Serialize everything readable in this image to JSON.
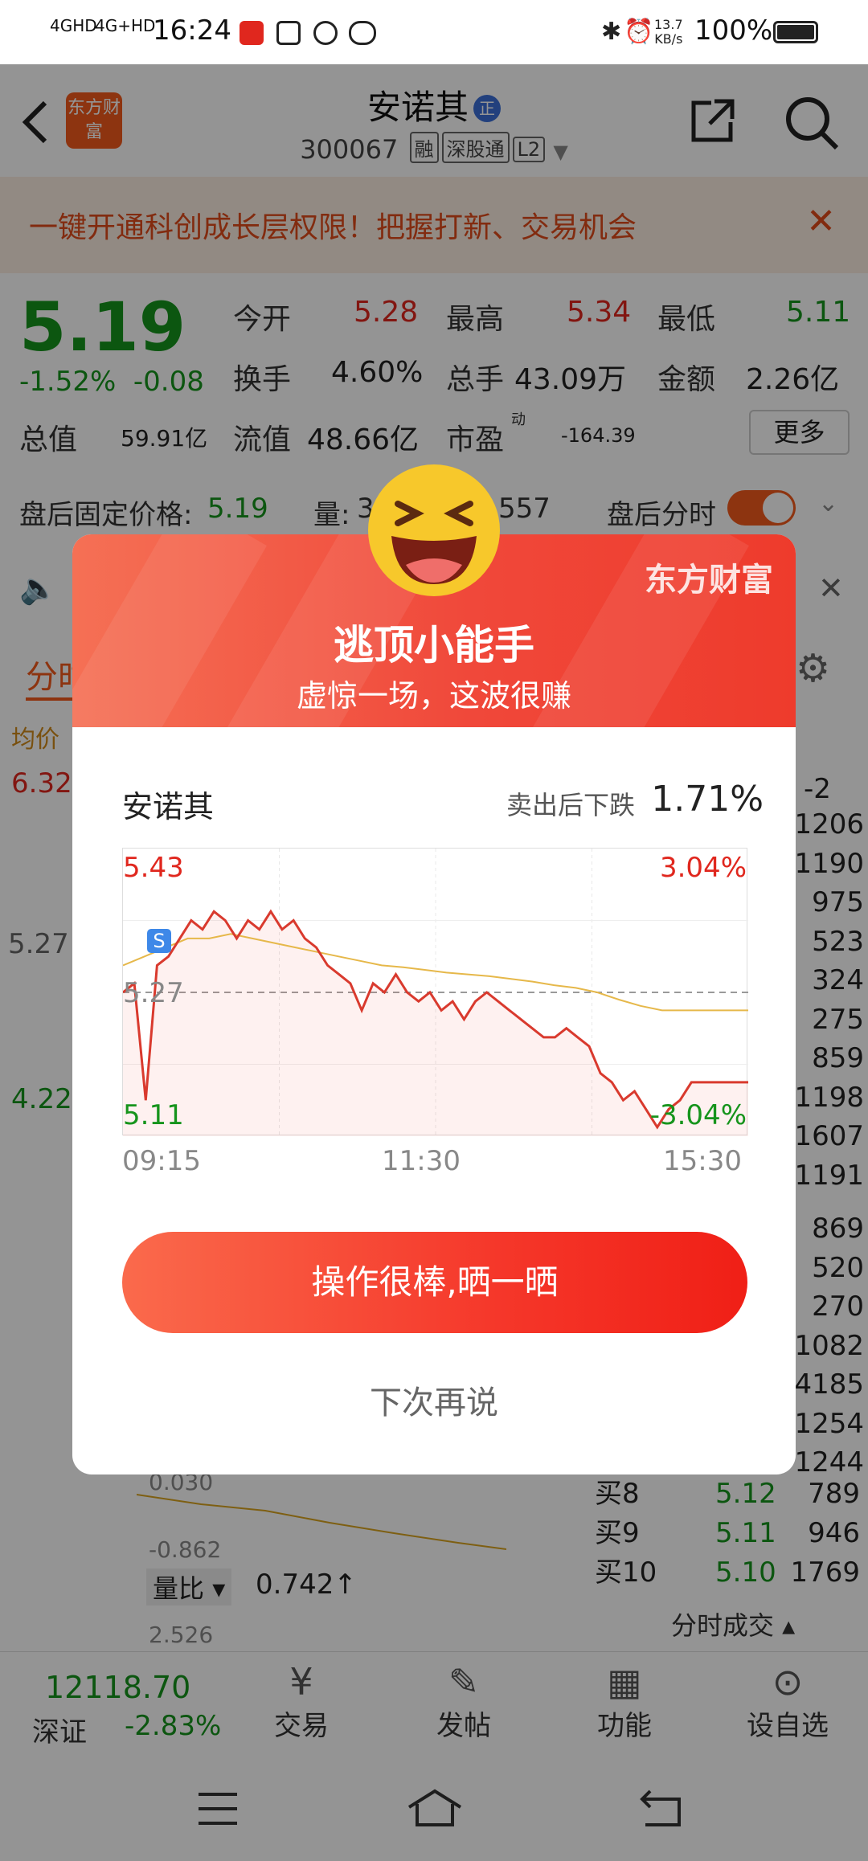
{
  "status_bar": {
    "network1": "4GHD",
    "network2": "4G+HD",
    "time": "16:24",
    "speed": "13.7",
    "speed_unit": "KB/s",
    "battery": "100%"
  },
  "header": {
    "logo_text": "东方财富",
    "stock_name": "安诺其",
    "stock_badge": "正",
    "stock_code": "300067",
    "tags": [
      "融",
      "深股通",
      "L2"
    ]
  },
  "banner": {
    "text": "一键开通科创成长层权限！把握打新、交易机会",
    "close": "✕"
  },
  "quote": {
    "price": "5.19",
    "change_pct": "-1.52%",
    "change_val": "-0.08",
    "open_label": "今开",
    "open_val": "5.28",
    "high_label": "最高",
    "high_val": "5.34",
    "low_label": "最低",
    "low_val": "5.11",
    "turnover_label": "换手",
    "turnover_val": "4.60%",
    "volume_label": "总手",
    "volume_val": "43.09万",
    "amount_label": "金额",
    "amount_val": "2.26亿",
    "mktcap_label": "总值",
    "mktcap_val": "59.91亿",
    "float_label": "流值",
    "float_val": "48.66亿",
    "pe_label": "市盈",
    "pe_sup": "动",
    "pe_val": "-164.39",
    "more_btn": "更多"
  },
  "after_hours": {
    "label": "盘后固定价格:",
    "price": "5.19",
    "vol_label": "量:",
    "vol_partial_left": "3",
    "vol_partial_right": "557",
    "timeshare_label": "盘后分时"
  },
  "bg_chart": {
    "tab": "分时",
    "avg_label": "均价",
    "ylabels": [
      "6.32",
      "5.27",
      "4.22"
    ],
    "indicator_vals": [
      "0.030",
      "-0.862"
    ],
    "vol_ratio_label": "量比",
    "vol_ratio_val": "0.742↑",
    "vol_ratio_scale": "2.526"
  },
  "order_book_visible": {
    "sell_partial": [
      "1206",
      "1190",
      "975",
      "523",
      "324",
      "275",
      "859",
      "1198",
      "1607",
      "1191"
    ],
    "buy_partial": [
      "869",
      "520",
      "270",
      "1082",
      "4185",
      "1254",
      "1244"
    ],
    "buy_rows": [
      {
        "label": "买8",
        "price": "5.12",
        "qty": "789"
      },
      {
        "label": "买9",
        "price": "5.11",
        "qty": "946"
      },
      {
        "label": "买10",
        "price": "5.10",
        "qty": "1769"
      }
    ],
    "footer": "分时成交 ▴",
    "header_partial": "-2"
  },
  "bottom_bar": {
    "index_val": "12118.70",
    "index_name": "深证",
    "index_chg": "-2.83%",
    "items": [
      "交易",
      "发帖",
      "功能",
      "设自选"
    ]
  },
  "modal": {
    "brand": "东方财富",
    "title": "逃顶小能手",
    "subtitle": "虚惊一场，这波很赚",
    "stock_name": "安诺其",
    "drop_label": "卖出后下跌",
    "drop_value": "1.71%",
    "chart_top_left": "5.43",
    "chart_top_right": "3.04%",
    "chart_mid_left": "5.27",
    "chart_bottom_left": "5.11",
    "chart_bottom_right": "-3.04%",
    "sell_marker": "S",
    "x_labels": [
      "09:15",
      "11:30",
      "15:30"
    ],
    "cta": "操作很棒,晒一晒",
    "later": "下次再说"
  },
  "chart_data": {
    "type": "line",
    "title": "",
    "xlabel": "",
    "ylabel": "",
    "x_ticks": [
      "09:15",
      "11:30",
      "15:30"
    ],
    "ylim": [
      5.11,
      5.43
    ],
    "reference_price": 5.27,
    "series": [
      {
        "values": [
          5.27,
          5.28,
          5.15,
          5.3,
          5.31,
          5.33,
          5.35,
          5.34,
          5.36,
          5.35,
          5.33,
          5.35,
          5.34,
          5.36,
          5.34,
          5.35,
          5.33,
          5.32,
          5.3,
          5.29,
          5.28,
          5.25,
          5.28,
          5.27,
          5.29,
          5.27,
          5.26,
          5.27,
          5.25,
          5.26,
          5.24,
          5.26,
          5.27,
          5.26,
          5.25,
          5.24,
          5.23,
          5.22,
          5.22,
          5.23,
          5.22,
          5.21,
          5.18,
          5.17,
          5.15,
          5.16,
          5.14,
          5.12,
          5.14,
          5.15,
          5.17,
          5.17,
          5.17,
          5.17,
          5.17,
          5.17
        ]
      },
      {
        "values": [
          5.3,
          5.31,
          5.32,
          5.33,
          5.33,
          5.335,
          5.33,
          5.325,
          5.32,
          5.315,
          5.31,
          5.305,
          5.3,
          5.298,
          5.295,
          5.292,
          5.29,
          5.288,
          5.285,
          5.282,
          5.278,
          5.275,
          5.27,
          5.262,
          5.255,
          5.25,
          5.25,
          5.25,
          5.25,
          5.25
        ]
      }
    ],
    "annotations": [
      "S"
    ]
  }
}
